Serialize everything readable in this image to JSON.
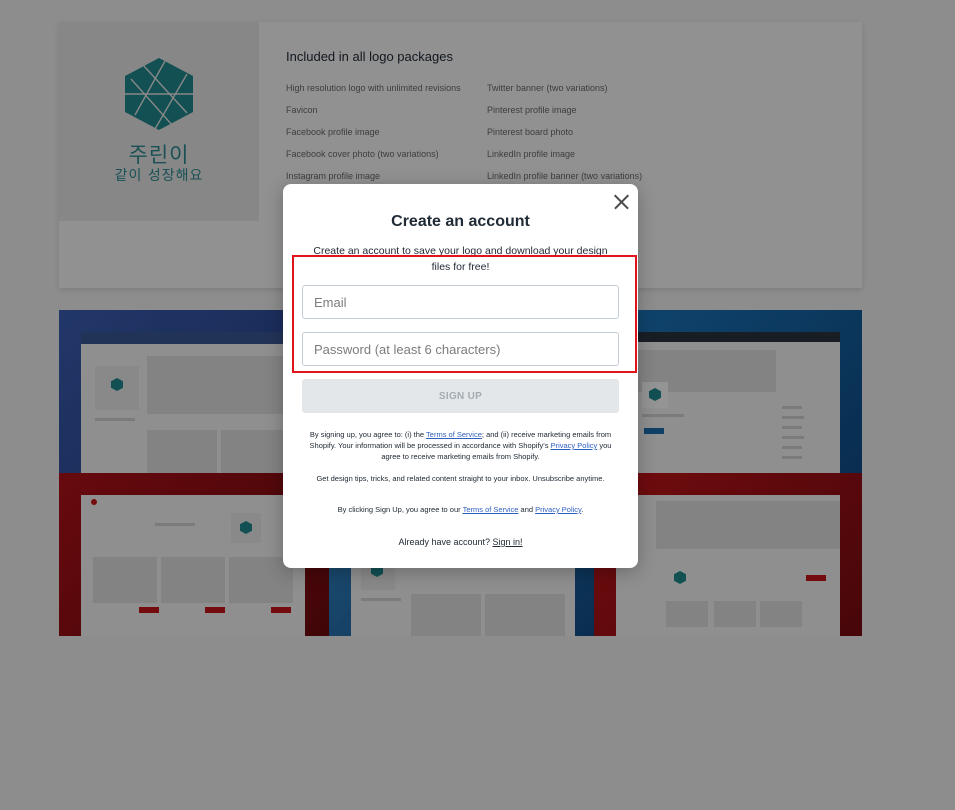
{
  "logo": {
    "name": "주린이",
    "tagline": "같이 성장해요",
    "color": "#1f8a91"
  },
  "packages": {
    "title": "Included in all logo packages",
    "left_items": [
      "High resolution logo with unlimited revisions",
      "Favicon",
      "Facebook profile image",
      "Facebook cover photo (two variations)",
      "Instagram profile image"
    ],
    "right_items": [
      "Twitter banner (two variations)",
      "Pinterest profile image",
      "Pinterest board photo",
      "LinkedIn profile image",
      "LinkedIn profile banner (two variations)"
    ]
  },
  "modal": {
    "title": "Create an account",
    "subtitle": "Create an account to save your logo and download your design files for free!",
    "close_icon": "close-icon",
    "email_placeholder": "Email",
    "password_placeholder": "Password (at least 6 characters)",
    "signup_label": "SIGN UP",
    "legal1": {
      "a": "By signing up, you agree to: (i) the ",
      "terms": "Terms of Service",
      "b": "; and (ii) receive marketing emails from Shopify. Your information will be processed in accordance with Shopify's ",
      "privacy": "Privacy Policy",
      "c": " you agree to receive marketing emails from Shopify."
    },
    "legal2": "Get design tips, tricks, and related content straight to your inbox. Unsubscribe anytime.",
    "legal3": {
      "a": "By clicking Sign Up, you agree to our ",
      "terms": "Terms of Service",
      "b": " and ",
      "privacy": "Privacy Policy",
      "c": "."
    },
    "signin_prompt": "Already have account? ",
    "signin_link": "Sign in!"
  },
  "colors": {
    "highlight": "#e0151b",
    "accent": "#2c8c93",
    "facebook_blue": "#3b5fb5",
    "twitter_blue": "#1a6fb0",
    "pinterest_red": "#b3121a"
  }
}
